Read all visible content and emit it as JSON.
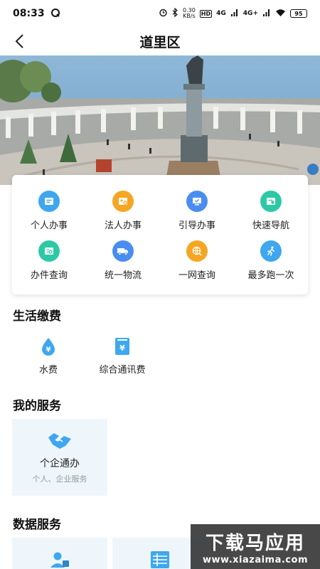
{
  "status_bar": {
    "time": "08:33",
    "network_speed_value": "0.30",
    "network_speed_unit": "KB/s",
    "hd_badge": "HD",
    "signal_4g": "4G",
    "signal_4g_plus": "4G+",
    "battery": "95"
  },
  "header": {
    "title": "道里区"
  },
  "services": [
    {
      "label": "个人办事",
      "icon": "person-list-icon",
      "color": "#3ea7ef"
    },
    {
      "label": "法人办事",
      "icon": "company-card-icon",
      "color": "#f5a623"
    },
    {
      "label": "引导办事",
      "icon": "monitor-check-icon",
      "color": "#4a8df0"
    },
    {
      "label": "快速导航",
      "icon": "navigation-card-icon",
      "color": "#2dc9a6"
    },
    {
      "label": "办件查询",
      "icon": "document-search-icon",
      "color": "#2dc9a6"
    },
    {
      "label": "统一物流",
      "icon": "delivery-truck-icon",
      "color": "#4a8df0"
    },
    {
      "label": "一网查询",
      "icon": "globe-search-icon",
      "color": "#f5a623"
    },
    {
      "label": "最多跑一次",
      "icon": "running-man-icon",
      "color": "#3ea7ef"
    }
  ],
  "life_payments": {
    "title": "生活缴费",
    "items": [
      {
        "label": "水费",
        "icon": "water-drop-yen-icon"
      },
      {
        "label": "综合通讯费",
        "icon": "phone-bill-yen-icon"
      }
    ]
  },
  "my_services": {
    "title": "我的服务",
    "card": {
      "title": "个企通办",
      "subtitle": "个人、企业服务",
      "icon": "handshake-icon"
    }
  },
  "data_services": {
    "title": "数据服务",
    "items": [
      {
        "icon": "person-data-icon"
      },
      {
        "icon": "list-data-icon"
      }
    ]
  },
  "watermark": {
    "title": "下载马应用",
    "url": "www.xiazaima.com"
  },
  "colors": {
    "accent": "#3ea7ef",
    "card_bg": "#eef6fc"
  }
}
